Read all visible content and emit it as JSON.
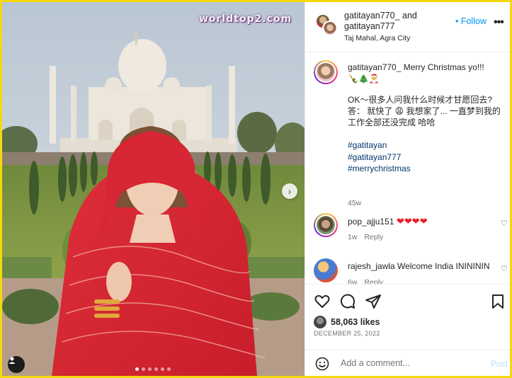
{
  "media": {
    "watermark": "worldtop2.com",
    "next_icon": "chevron-right-icon",
    "tag_icon": "user-tag-icon",
    "carousel_dots": 6,
    "carousel_active": 0
  },
  "header": {
    "user1": "gatitayan770_",
    "and_text": " and",
    "user2": "gatitayan777",
    "location": "Taj Mahal, Agra City",
    "follow_label": "• Follow",
    "more_icon": "•••"
  },
  "caption": {
    "username": "gatitayan770_",
    "line1": " Merry Christmas yo!!!",
    "emojis": "🍾🎄🎅",
    "line2": "OK～很多人问我什么时候才甘愿回去?",
    "line3": "答：  就快了 😩 我想家了... 一直梦到我的工作全部还没完成 哈哈",
    "hashtags": [
      "#gatitayan",
      "#gatitayan777",
      "#merrychristmas"
    ],
    "time": "45w"
  },
  "comments": [
    {
      "username": "pop_ajju151",
      "text": " ❤❤❤❤",
      "time": "1w",
      "reply_label": "Reply"
    },
    {
      "username": "rajesh_jawla",
      "text": " Welcome India ININININ",
      "time": "6w",
      "reply_label": "Reply"
    }
  ],
  "actions": {
    "likes_count": "58,063",
    "likes_label": " likes",
    "date": "DECEMBER 25, 2022"
  },
  "add_comment": {
    "placeholder": "Add a comment...",
    "post_label": "Post"
  },
  "colors": {
    "accent": "#0095f6",
    "frame": "#f4d90f",
    "hashtag": "#00376b",
    "muted": "#737373"
  }
}
